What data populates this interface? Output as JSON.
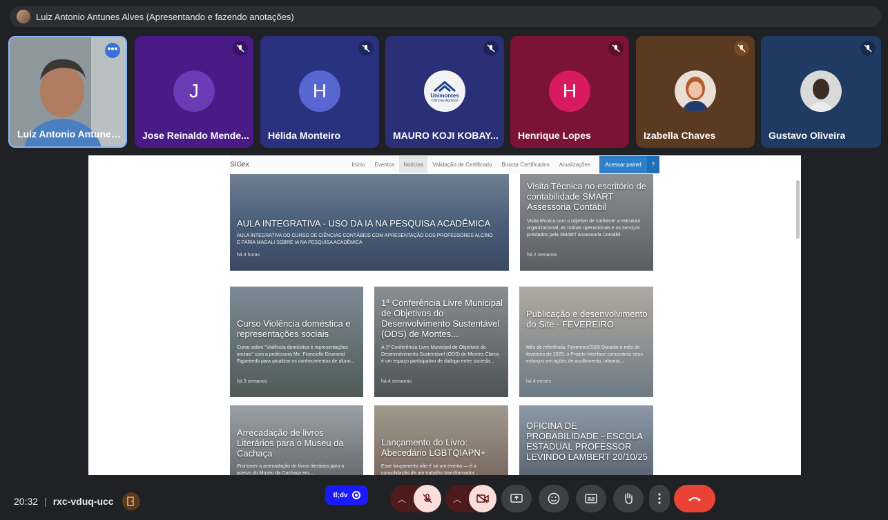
{
  "banner": {
    "text": "Luiz Antonio Antunes Alves (Apresentando e fazendo anotações)"
  },
  "participants": [
    {
      "name": "Luiz Antonio Antunes...",
      "type": "video"
    },
    {
      "name": "Jose Reinaldo Mende...",
      "initial": "J",
      "bg": "#4a1a86",
      "avatar_color": "#6a3bb5"
    },
    {
      "name": "Hélida Monteiro",
      "initial": "H",
      "bg": "#2a3280",
      "avatar_color": "#5766d0"
    },
    {
      "name": "MAURO KOJI KOBAY...",
      "logo_title": "Unimontes",
      "logo_sub": "Ciências Agrárias",
      "bg": "#2a2f78"
    },
    {
      "name": "Henrique Lopes",
      "initial": "H",
      "bg": "#7a1335",
      "avatar_color": "#d81b60"
    },
    {
      "name": "Izabella Chaves",
      "bg": "#5b3a22",
      "type": "photo"
    },
    {
      "name": "Gustavo Oliveira",
      "bg": "#1f3b63",
      "type": "photo"
    }
  ],
  "site": {
    "brand": "SIGex",
    "nav": [
      "Início",
      "Eventos",
      "Notícias",
      "Validação de Certificado",
      "Buscar Certificados",
      "Atualizações"
    ],
    "cta": "Acessar painel",
    "help": "?",
    "cards": [
      {
        "title": "AULA INTEGRATIVA - USO DA IA NA PESQUISA ACADÊMICA",
        "desc": "AULA INTEGRATIVA DO CURSO DE CIÊNCIAS CONTÁBEIS COM APRESENTAÇÃO DOS PROFESSORES ALCINO E FÁRIA MAGALI SOBRE IA NA PESQUISA ACADÊMICA",
        "ago": "há 4 horas"
      },
      {
        "title": "Visita Técnica no escritório de contabilidade SMART Assessoria Contábil",
        "desc": "Visita técnica com o objetivo de conhecer a estrutura organizacional, as rotinas operacionais e os serviços prestados pela SMART Assessoria Contábil",
        "ago": "há 2 semanas"
      },
      {
        "title": "Curso Violência doméstica e representações sociais",
        "desc": "Curso sobre \"Violência doméstica e representações sociais\" com a professora Me. Francielle Drumond Figueiredo para atualizar os conhecimentos de aluno...",
        "ago": "há 3 semanas"
      },
      {
        "title": "1ª Conferência Livre Municipal de Objetivos do Desenvolvimento Sustentável (ODS) de Montes...",
        "desc": "A 1ª Conferência Livre Municipal de Objetivos do Desenvolvimento Sustentável (ODS) de Montes Claros é um espaço participativo de diálogo entre socieda...",
        "ago": "há 4 semanas"
      },
      {
        "title": "Publicação e desenvolvimento do Site - FEVEREIRO",
        "desc": "Mês de referência: Fevereiro/2025 Durante o mês de fevereiro de 2025, o Projeto Interface concentrou seus esforços em ações de acolhimento, informa...",
        "ago": "há 4 meses"
      },
      {
        "title": "Arrecadação de livros Literários para o Museu da Cachaça",
        "desc": "Promover a arrecadação de livros literários para o acervo do Museu da Cachaça em...",
        "ago": ""
      },
      {
        "title": "Lançamento do Livro: Abecedário LGBTQIAPN+",
        "desc": "Esse lançamento não é só um evento — é a consolidação de um trabalho transformador...",
        "ago": ""
      },
      {
        "title": "OFICINA DE PROBABILIDADE - ESCOLA ESTADUAL PROFESSOR LEVINDO LAMBERT 20/10/25",
        "desc": "",
        "ago": ""
      }
    ]
  },
  "footer": {
    "time": "20:32",
    "separator": "|",
    "meeting_code": "rxc-vduq-ucc",
    "live_pill": "tl;dv"
  },
  "colors": {
    "background": "#202124",
    "hangup": "#ea4335",
    "accent": "#8ab4f8"
  }
}
